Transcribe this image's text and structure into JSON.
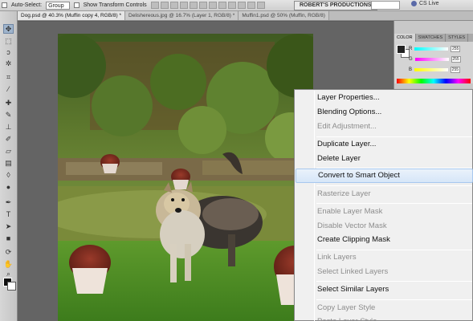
{
  "options_bar": {
    "auto_select_label": "Auto-Select:",
    "auto_select_value": "Group",
    "show_transform_label": "Show Transform Controls",
    "workspace_button": "ROBERT'S PRODUCTIONS",
    "cs_live": "CS Live"
  },
  "tabs": [
    {
      "label": "Dog.psd @ 40.3% (Muffin copy 4, RGB/8) *",
      "active": true
    },
    {
      "label": "Delishereous.jpg @ 16.7% (Layer 1, RGB/8) *",
      "active": false
    },
    {
      "label": "Muffin1.psd @ 50% (Muffin, RGB/8)",
      "active": false
    }
  ],
  "panels": {
    "tabs": [
      "COLOR",
      "SWATCHES",
      "STYLES"
    ],
    "color": {
      "channels": [
        {
          "label": "R",
          "value": "255"
        },
        {
          "label": "G",
          "value": "255"
        },
        {
          "label": "B",
          "value": "255"
        }
      ]
    }
  },
  "context_menu": {
    "items": [
      {
        "label": "Layer Properties...",
        "disabled": false
      },
      {
        "label": "Blending Options...",
        "disabled": false
      },
      {
        "label": "Edit Adjustment...",
        "disabled": true
      },
      {
        "label": "Duplicate Layer...",
        "disabled": false
      },
      {
        "label": "Delete Layer",
        "disabled": false
      },
      {
        "label": "Convert to Smart Object",
        "disabled": false,
        "highlighted": true
      },
      {
        "label": "Rasterize Layer",
        "disabled": true
      },
      {
        "label": "Enable Layer Mask",
        "disabled": true
      },
      {
        "label": "Disable Vector Mask",
        "disabled": true
      },
      {
        "label": "Create Clipping Mask",
        "disabled": false
      },
      {
        "label": "Link Layers",
        "disabled": true
      },
      {
        "label": "Select Linked Layers",
        "disabled": true
      },
      {
        "label": "Select Similar Layers",
        "disabled": false
      },
      {
        "label": "Copy Layer Style",
        "disabled": true
      },
      {
        "label": "Paste Layer Style",
        "disabled": true
      }
    ]
  },
  "colors": {
    "menu_highlight": "#d6e6f8",
    "disabled_text": "#8d8d8d",
    "workspace_bg": "#646464"
  },
  "icons": [
    "move-tool-icon",
    "marquee-tool-icon",
    "lasso-tool-icon",
    "magic-wand-icon",
    "crop-tool-icon",
    "eyedropper-icon",
    "healing-brush-icon",
    "brush-tool-icon",
    "clone-stamp-icon",
    "history-brush-icon",
    "eraser-icon",
    "gradient-tool-icon",
    "blur-tool-icon",
    "dodge-tool-icon",
    "pen-tool-icon",
    "type-tool-icon",
    "path-selection-icon",
    "shape-tool-icon",
    "3d-rotate-icon",
    "hand-tool-icon",
    "zoom-tool-icon"
  ]
}
